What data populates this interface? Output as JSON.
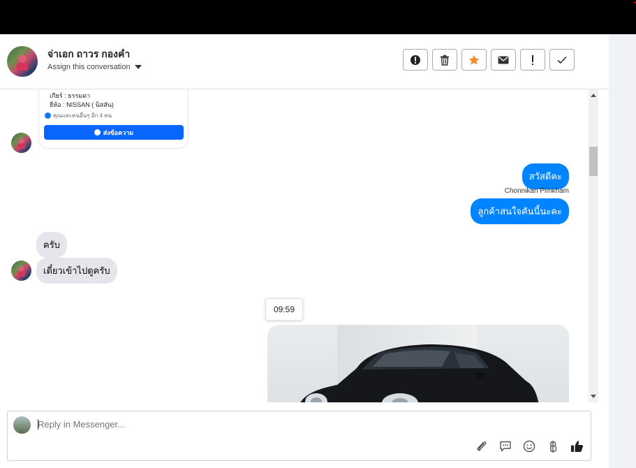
{
  "header": {
    "contact_name": "จ่าเอก ถาวร กองคำ",
    "assign_label": "Assign this conversation",
    "actions": [
      {
        "icon": "alert-circle-icon"
      },
      {
        "icon": "trash-icon"
      },
      {
        "icon": "star-icon",
        "color": "#f28a2e"
      },
      {
        "icon": "mail-icon"
      },
      {
        "icon": "exclamation-icon"
      },
      {
        "icon": "check-icon"
      }
    ]
  },
  "thread": {
    "card": {
      "line1": "เกียร์ : ธรรมดา",
      "line2": "ยี่ห้อ : NISSAN ( นิสสัน)",
      "reactions": "คุณและคนอื่นๆ อีก 4 คน",
      "button": "ส่งข้อความ"
    },
    "messages": [
      {
        "direction": "out",
        "text": "สวัสดีคะ"
      },
      {
        "direction": "out",
        "sender": "Chonnikan Pimkham",
        "text": "ลูกค้าสนใจคันนี้นะคะ"
      },
      {
        "direction": "in",
        "text": "ครับ"
      },
      {
        "direction": "in",
        "text": "เดี๋ยวเข้าไปดูครับ"
      }
    ],
    "timestamp": "09:59",
    "colors": {
      "outgoing": "#0084ff",
      "incoming": "#e4e6eb"
    }
  },
  "composer": {
    "placeholder": "Reply in Messenger...",
    "tools": [
      "paperclip-icon",
      "chat-bubble-icon",
      "smiley-icon",
      "baht-icon",
      "thumbs-up-icon"
    ]
  }
}
